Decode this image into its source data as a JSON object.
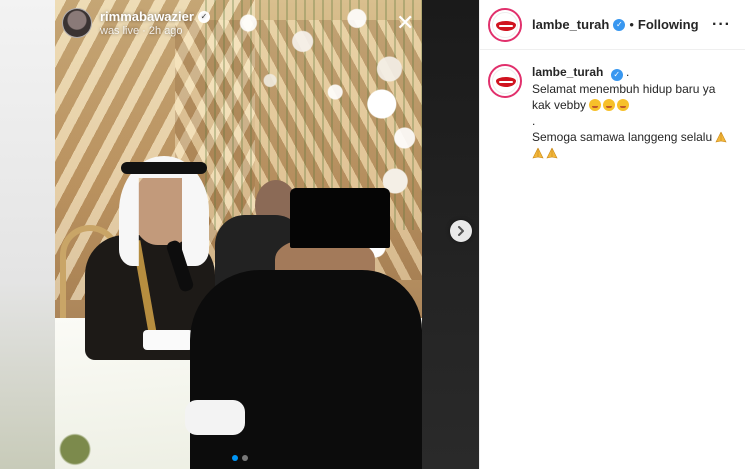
{
  "story": {
    "username": "rimmabawazier",
    "subtext": "was live · 2h ago",
    "close_glyph": "✕"
  },
  "carousel": {
    "active_index": 1,
    "count": 2
  },
  "header": {
    "username": "lambe_turah",
    "separator": "•",
    "follow_label": "Following",
    "more_glyph": "···"
  },
  "caption": {
    "username": "lambe_turah",
    "after_name": ".",
    "line1": "Selamat menembuh hidup baru ya kak vebby",
    "line2": ".",
    "line3": "Semoga samawa langgeng selalu"
  },
  "icons": {
    "verified": "verified-badge-icon",
    "emoji": "kiss-face-emoji",
    "pray": "folded-hands-emoji",
    "next": "chevron-right-icon",
    "close": "close-icon"
  },
  "colors": {
    "accent": "#0095f6",
    "verified": "#3897f0",
    "text": "#262626",
    "brand_red": "#d0131f"
  }
}
